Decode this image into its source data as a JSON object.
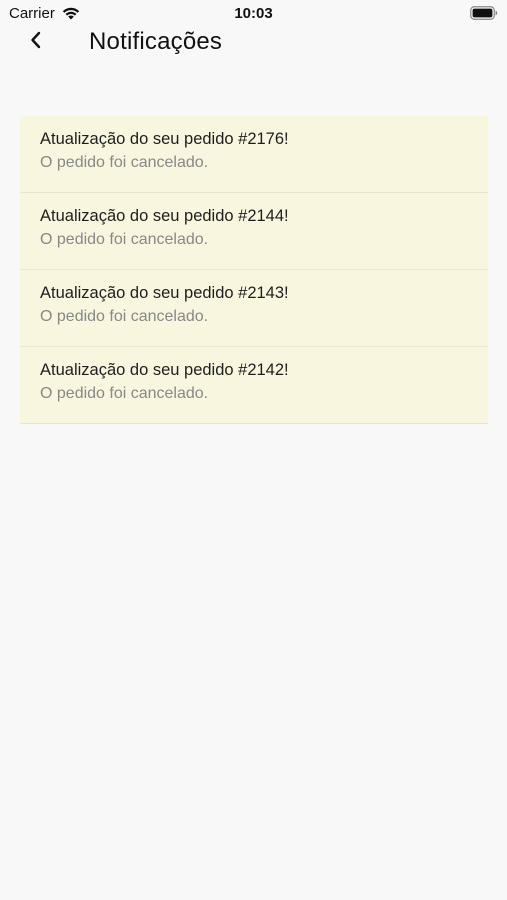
{
  "status_bar": {
    "carrier": "Carrier",
    "time": "10:03",
    "icons": [
      "wifi-icon",
      "battery-icon"
    ]
  },
  "header": {
    "back_icon": "chevron-left-icon",
    "title": "Notificações"
  },
  "notifications": [
    {
      "title": "Atualização do seu pedido #2176!",
      "body": "O pedido foi cancelado."
    },
    {
      "title": "Atualização do seu pedido #2144!",
      "body": "O pedido foi cancelado."
    },
    {
      "title": "Atualização do seu pedido #2143!",
      "body": "O pedido foi cancelado."
    },
    {
      "title": "Atualização do seu pedido #2142!",
      "body": "O pedido foi cancelado."
    }
  ],
  "colors": {
    "background": "#f8f8f8",
    "notification_bg": "#f8f6de",
    "title_text": "#1e1e1e",
    "body_text": "#888888"
  }
}
